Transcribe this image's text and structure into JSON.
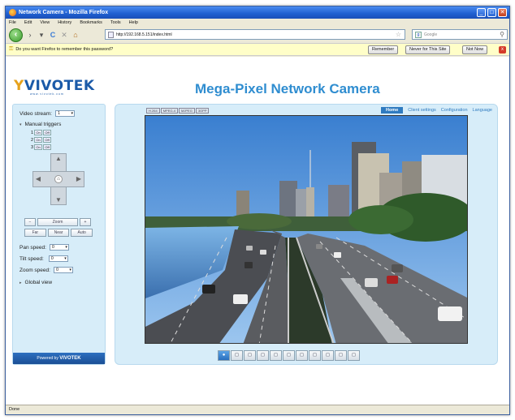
{
  "window": {
    "title": "Network Camera - Mozilla Firefox",
    "controls": {
      "minimize": "_",
      "maximize": "□",
      "close": "✕"
    }
  },
  "menu": [
    "File",
    "Edit",
    "View",
    "History",
    "Bookmarks",
    "Tools",
    "Help"
  ],
  "nav": {
    "url": "http://192.168.5.151/index.html",
    "search_engine": "g",
    "search_placeholder": "Google"
  },
  "notification": {
    "message": "Do you want Firefox to remember this password?",
    "remember_label": "Remember",
    "never_label": "Never for This Site",
    "not_now_label": "Not Now",
    "close": "x"
  },
  "camera": {
    "logo_main": "VIVOTEK",
    "logo_y": "Y",
    "logo_sub": "www.vivotek.com",
    "title": "Mega-Pixel Network Camera",
    "video_stream_label": "Video stream:",
    "video_stream_value": "1",
    "manual_triggers_label": "Manual triggers",
    "triggers": [
      {
        "number": "1",
        "on": "On",
        "off": "Off"
      },
      {
        "number": "2",
        "on": "On",
        "off": "Off"
      },
      {
        "number": "3",
        "on": "On",
        "off": "Off"
      }
    ],
    "zoom_label": "Zoom",
    "zoom_minus": "−",
    "zoom_plus": "+",
    "focus_buttons": [
      "Far",
      "Near",
      "Auto"
    ],
    "pan_speed_label": "Pan speed:",
    "pan_speed_value": "0",
    "tilt_speed_label": "Tilt speed:",
    "tilt_speed_value": "0",
    "zoom_speed_label": "Zoom speed:",
    "zoom_speed_value": "0",
    "global_view_label": "Global view",
    "powered_by": "Powered by",
    "powered_brand": "VIVOTEK",
    "formats": [
      "H.264",
      "MPEG-4",
      "MJPEG",
      "3GPP"
    ],
    "links": {
      "home": "Home",
      "client_settings": "Client settings",
      "configuration": "Configuration",
      "language": "Language"
    },
    "control_buttons": [
      "●",
      "◻",
      "◻",
      "◻",
      "◻",
      "◻",
      "◻",
      "◻",
      "◻",
      "◻",
      "◻"
    ]
  },
  "status": "Done"
}
